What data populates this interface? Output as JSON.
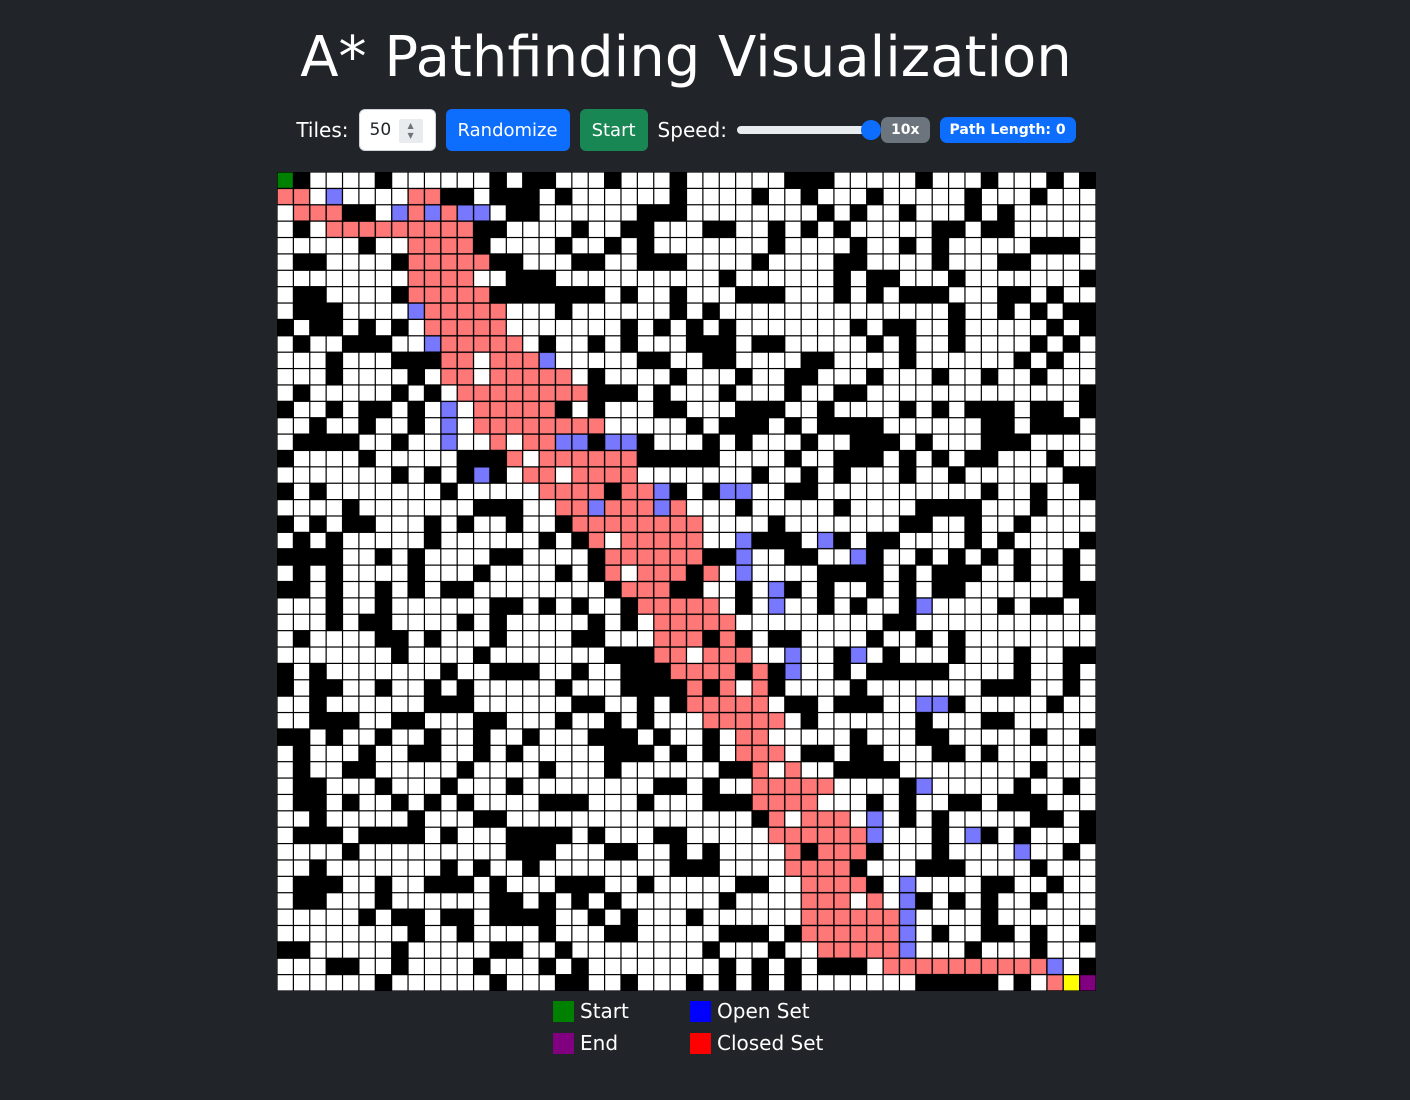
{
  "title": "A* Pathfinding Visualization",
  "controls": {
    "tiles_label": "Tiles:",
    "tiles_value": "50",
    "randomize_label": "Randomize",
    "start_label": "Start",
    "speed_label": "Speed:",
    "speed_fraction": 1.0,
    "speed_badge": "10x",
    "path_length": "Path Length: 0"
  },
  "grid": {
    "size": 50,
    "colors": {
      "open": "#ffffff",
      "wall": "#000000",
      "open_set": "#7878ff",
      "closed_set": "#ff7878",
      "start": "#008000",
      "end": "#800080",
      "current": "#ffff00"
    },
    "wall_density": 0.33,
    "start": [
      0,
      0
    ],
    "end": [
      49,
      49
    ],
    "current": [
      49,
      48
    ],
    "closed_path": [
      [
        1,
        0
      ],
      [
        1,
        1
      ],
      [
        2,
        1
      ],
      [
        2,
        2
      ],
      [
        2,
        3
      ],
      [
        3,
        3
      ],
      [
        3,
        4
      ],
      [
        3,
        5
      ],
      [
        3,
        6
      ],
      [
        3,
        7
      ],
      [
        3,
        8
      ],
      [
        3,
        9
      ],
      [
        3,
        10
      ],
      [
        4,
        9
      ],
      [
        5,
        9
      ],
      [
        6,
        9
      ],
      [
        7,
        9
      ],
      [
        8,
        10
      ],
      [
        9,
        10
      ],
      [
        10,
        10
      ],
      [
        11,
        11
      ],
      [
        12,
        11
      ],
      [
        13,
        11
      ],
      [
        14,
        12
      ],
      [
        15,
        12
      ],
      [
        16,
        13
      ],
      [
        17,
        14
      ],
      [
        18,
        15
      ],
      [
        19,
        16
      ],
      [
        20,
        17
      ],
      [
        21,
        18
      ],
      [
        22,
        19
      ],
      [
        23,
        20
      ],
      [
        24,
        20
      ],
      [
        25,
        21
      ],
      [
        26,
        22
      ],
      [
        27,
        23
      ],
      [
        28,
        24
      ],
      [
        29,
        24
      ],
      [
        30,
        24
      ],
      [
        31,
        25
      ],
      [
        32,
        26
      ],
      [
        33,
        27
      ],
      [
        34,
        28
      ],
      [
        35,
        28
      ],
      [
        36,
        29
      ],
      [
        37,
        29
      ],
      [
        38,
        30
      ],
      [
        39,
        30
      ],
      [
        40,
        31
      ],
      [
        41,
        31
      ],
      [
        42,
        32
      ],
      [
        43,
        32
      ],
      [
        44,
        33
      ],
      [
        45,
        34
      ],
      [
        46,
        35
      ],
      [
        47,
        36
      ],
      [
        48,
        37
      ],
      [
        48,
        38
      ],
      [
        48,
        39
      ],
      [
        48,
        40
      ],
      [
        48,
        41
      ],
      [
        48,
        42
      ],
      [
        48,
        43
      ],
      [
        48,
        44
      ],
      [
        48,
        45
      ],
      [
        48,
        46
      ],
      [
        48,
        47
      ],
      [
        49,
        47
      ]
    ],
    "closed_blobs": [
      [
        3,
        9,
        2
      ],
      [
        6,
        10,
        2
      ],
      [
        9,
        11,
        2
      ],
      [
        11,
        12,
        2
      ],
      [
        13,
        14,
        2
      ],
      [
        14,
        16,
        2
      ],
      [
        17,
        18,
        2
      ],
      [
        19,
        20,
        2
      ],
      [
        22,
        23,
        2
      ],
      [
        25,
        24,
        2
      ],
      [
        28,
        25,
        2
      ],
      [
        31,
        27,
        2
      ],
      [
        34,
        29,
        1
      ],
      [
        38,
        31,
        2
      ],
      [
        41,
        33,
        2
      ],
      [
        45,
        34,
        2
      ],
      [
        46,
        37,
        1
      ]
    ],
    "open_set_cells": [
      [
        1,
        3
      ],
      [
        2,
        7
      ],
      [
        2,
        9
      ],
      [
        2,
        11
      ],
      [
        2,
        12
      ],
      [
        8,
        8
      ],
      [
        10,
        9
      ],
      [
        14,
        10
      ],
      [
        15,
        10
      ],
      [
        16,
        10
      ],
      [
        18,
        12
      ],
      [
        11,
        16
      ],
      [
        16,
        17
      ],
      [
        16,
        18
      ],
      [
        20,
        19
      ],
      [
        16,
        20
      ],
      [
        16,
        21
      ],
      [
        19,
        23
      ],
      [
        20,
        23
      ],
      [
        19,
        27
      ],
      [
        19,
        28
      ],
      [
        22,
        28
      ],
      [
        23,
        28
      ],
      [
        24,
        28
      ],
      [
        25,
        30
      ],
      [
        26,
        30
      ],
      [
        29,
        31
      ],
      [
        30,
        31
      ],
      [
        22,
        33
      ],
      [
        23,
        35
      ],
      [
        29,
        35
      ],
      [
        39,
        36
      ],
      [
        40,
        36
      ],
      [
        43,
        38
      ],
      [
        44,
        38
      ],
      [
        45,
        38
      ],
      [
        46,
        38
      ],
      [
        47,
        38
      ],
      [
        26,
        39
      ],
      [
        32,
        39
      ],
      [
        37,
        39
      ],
      [
        32,
        40
      ],
      [
        40,
        42
      ],
      [
        41,
        45
      ],
      [
        48,
        47
      ]
    ]
  },
  "legend": {
    "start": "Start",
    "end": "End",
    "open_set": "Open Set",
    "closed_set": "Closed Set",
    "start_color": "#008000",
    "end_color": "#800080",
    "open_color": "#0000ff",
    "closed_color": "#ff0000"
  }
}
